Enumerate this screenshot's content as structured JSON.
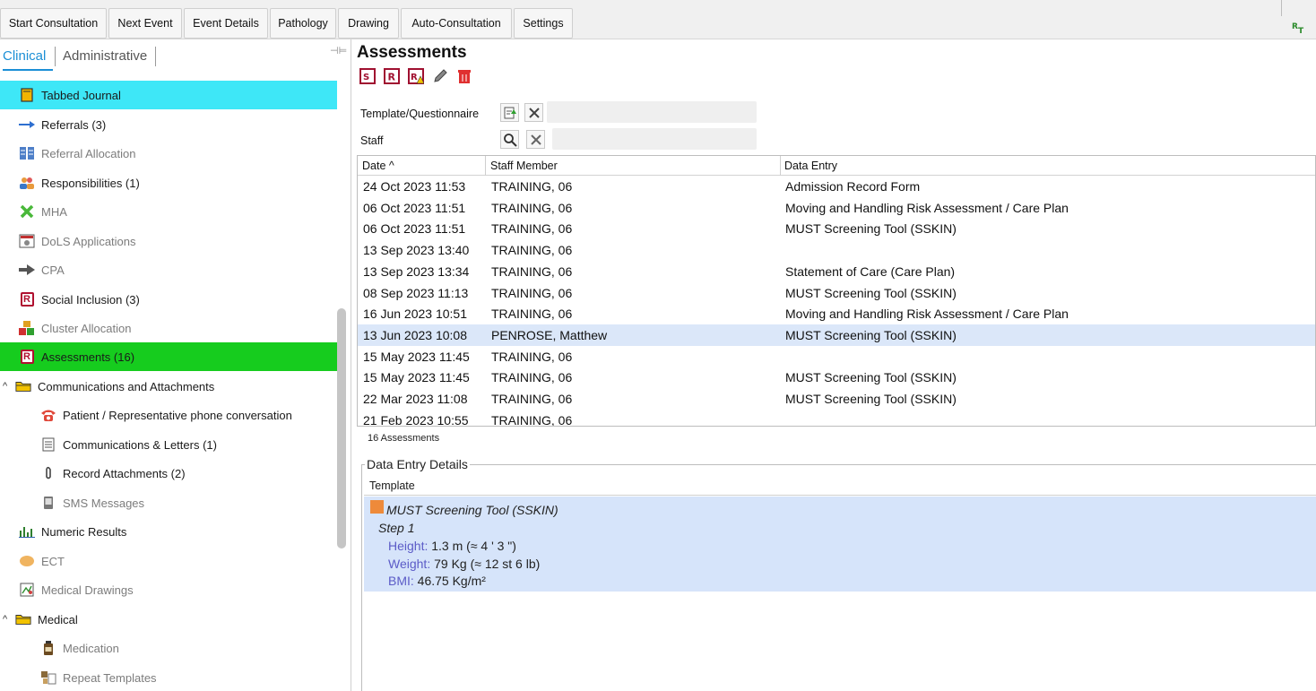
{
  "toolbar": {
    "buttons": [
      {
        "label": "Start Consultation"
      },
      {
        "label": "Next Event"
      },
      {
        "label": "Event Details"
      },
      {
        "label": "Pathology"
      },
      {
        "label": "Drawing"
      },
      {
        "label": "Auto-Consultation"
      },
      {
        "label": "Settings"
      }
    ],
    "right_icon": "rt-icon"
  },
  "left_panel": {
    "tabs": [
      {
        "label": "Clinical",
        "active": true
      },
      {
        "label": "Administrative",
        "active": false
      }
    ],
    "items": [
      {
        "label": "Tabbed Journal",
        "icon": "journal-icon",
        "state": "selected-cyan"
      },
      {
        "label": "Referrals (3)",
        "icon": "arrow-right-icon",
        "state": "normal"
      },
      {
        "label": "Referral Allocation",
        "icon": "allocation-icon",
        "state": "dim"
      },
      {
        "label": "Responsibilities (1)",
        "icon": "people-icon",
        "state": "normal"
      },
      {
        "label": "MHA",
        "icon": "x-mark-icon",
        "state": "dim"
      },
      {
        "label": "DoLS Applications",
        "icon": "dols-icon",
        "state": "dim"
      },
      {
        "label": "CPA",
        "icon": "arrow-bold-icon",
        "state": "dim"
      },
      {
        "label": "Social Inclusion (3)",
        "icon": "r-form-icon",
        "state": "normal"
      },
      {
        "label": "Cluster Allocation",
        "icon": "cluster-icon",
        "state": "dim"
      },
      {
        "label": "Assessments (16)",
        "icon": "r-form-icon",
        "state": "selected-green"
      },
      {
        "label": "Communications and Attachments",
        "icon": "folder-icon",
        "state": "group"
      },
      {
        "label": "Patient / Representative phone conversation",
        "icon": "phone-icon",
        "state": "child"
      },
      {
        "label": "Communications & Letters (1)",
        "icon": "letter-icon",
        "state": "child"
      },
      {
        "label": "Record Attachments (2)",
        "icon": "paperclip-icon",
        "state": "child"
      },
      {
        "label": "SMS Messages",
        "icon": "sms-icon",
        "state": "child-dim"
      },
      {
        "label": "Numeric Results",
        "icon": "chart-icon",
        "state": "normal"
      },
      {
        "label": "ECT",
        "icon": "ect-icon",
        "state": "dim"
      },
      {
        "label": "Medical Drawings",
        "icon": "drawing-icon",
        "state": "dim"
      },
      {
        "label": "Medical",
        "icon": "folder-icon",
        "state": "group"
      },
      {
        "label": "Medication",
        "icon": "medication-icon",
        "state": "child-dim"
      },
      {
        "label": "Repeat Templates",
        "icon": "repeat-templates-icon",
        "state": "child-dim"
      }
    ]
  },
  "main": {
    "title": "Assessments",
    "toolbar_icons": [
      "add-assessment-icon",
      "r-form-icon",
      "warning-form-icon",
      "edit-pencil-icon",
      "delete-bin-icon"
    ],
    "filters": {
      "template_label": "Template/Questionnaire",
      "staff_label": "Staff",
      "template_value": "",
      "staff_value": ""
    },
    "grid": {
      "columns": [
        "Date ^",
        "Staff Member",
        "Data Entry"
      ],
      "rows": [
        {
          "date": "24 Oct 2023 11:53",
          "staff": "TRAINING, 06",
          "entry": "Admission Record Form",
          "selected": false
        },
        {
          "date": "06 Oct 2023 11:51",
          "staff": "TRAINING, 06",
          "entry": "Moving and Handling Risk Assessment / Care Plan",
          "selected": false
        },
        {
          "date": "06 Oct 2023 11:51",
          "staff": "TRAINING, 06",
          "entry": "MUST Screening Tool (SSKIN)",
          "selected": false
        },
        {
          "date": "13 Sep 2023 13:40",
          "staff": "TRAINING, 06",
          "entry": "",
          "selected": false
        },
        {
          "date": "13 Sep 2023 13:34",
          "staff": "TRAINING, 06",
          "entry": "Statement of Care (Care Plan)",
          "selected": false
        },
        {
          "date": "08 Sep 2023 11:13",
          "staff": "TRAINING, 06",
          "entry": "MUST Screening Tool (SSKIN)",
          "selected": false
        },
        {
          "date": "16 Jun 2023 10:51",
          "staff": "TRAINING, 06",
          "entry": "Moving and Handling Risk Assessment / Care Plan",
          "selected": false
        },
        {
          "date": "13 Jun 2023 10:08",
          "staff": "PENROSE, Matthew",
          "entry": "MUST Screening Tool (SSKIN)",
          "selected": true
        },
        {
          "date": "15 May 2023 11:45",
          "staff": "TRAINING, 06",
          "entry": "",
          "selected": false
        },
        {
          "date": "15 May 2023 11:45",
          "staff": "TRAINING, 06",
          "entry": "MUST Screening Tool (SSKIN)",
          "selected": false
        },
        {
          "date": "22 Mar 2023 11:08",
          "staff": "TRAINING, 06",
          "entry": "MUST Screening Tool (SSKIN)",
          "selected": false
        },
        {
          "date": "21 Feb 2023 10:55",
          "staff": "TRAINING, 06",
          "entry": "",
          "selected": false
        }
      ],
      "count_label": "16 Assessments"
    },
    "details": {
      "legend": "Data Entry Details",
      "column": "Template",
      "template_name": "MUST Screening Tool (SSKIN)",
      "step": "Step 1",
      "fields": [
        {
          "key": "Height:",
          "value": "1.3 m  (≈ 4 ' 3 \")"
        },
        {
          "key": "Weight:",
          "value": "79 Kg  (≈ 12 st 6 lb)"
        },
        {
          "key": "BMI:",
          "value": "46.75 Kg/m²"
        }
      ]
    }
  },
  "colors": {
    "accent_blue": "#1b8fd6",
    "selected_cyan": "#3ee7f7",
    "selected_green": "#16cc1e",
    "row_selected": "#dbe7f9",
    "details_bg": "#d6e4fa"
  }
}
